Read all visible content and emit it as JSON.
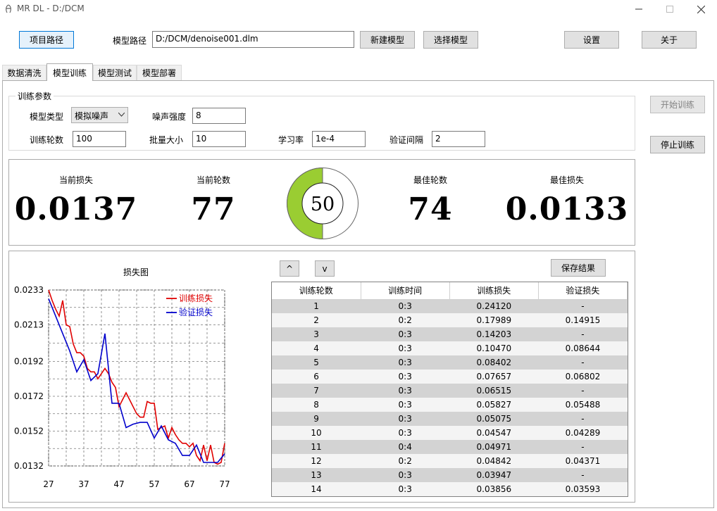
{
  "window": {
    "title": "MR DL - D:/DCM"
  },
  "toolbar": {
    "project_path_label": "项目路径",
    "model_path_label": "模型路径",
    "model_path_value": "D:/DCM/denoise001.dlm",
    "new_model_label": "新建模型",
    "select_model_label": "选择模型",
    "settings_label": "设置",
    "about_label": "关于"
  },
  "tabs": [
    {
      "label": "数据清洗"
    },
    {
      "label": "模型训练"
    },
    {
      "label": "模型测试"
    },
    {
      "label": "模型部署"
    }
  ],
  "params": {
    "group_title": "训练参数",
    "model_type_label": "模型类型",
    "model_type_value": "模拟噪声",
    "noise_label": "噪声强度",
    "noise_value": "8",
    "epochs_label": "训练轮数",
    "epochs_value": "100",
    "batch_label": "批量大小",
    "batch_value": "10",
    "lr_label": "学习率",
    "lr_value": "1e-4",
    "val_interval_label": "验证间隔",
    "val_interval_value": "2"
  },
  "actions": {
    "start_label": "开始训练",
    "stop_label": "停止训练"
  },
  "metrics": {
    "current_loss_label": "当前损失",
    "current_loss_value": "0.0137",
    "current_epoch_label": "当前轮数",
    "current_epoch_value": "77",
    "progress_value": "50",
    "progress_fraction": 0.5,
    "best_epoch_label": "最佳轮数",
    "best_epoch_value": "74",
    "best_loss_label": "最佳损失",
    "best_loss_value": "0.0133"
  },
  "colors": {
    "progress_fill": "#9acd32",
    "train_line": "#e00000",
    "val_line": "#0000cc"
  },
  "table": {
    "up_label": "^",
    "down_label": "v",
    "save_label": "保存结果",
    "columns": [
      "训练轮数",
      "训练时间",
      "训练损失",
      "验证损失"
    ],
    "rows": [
      [
        "1",
        "0:3",
        "0.24120",
        "-"
      ],
      [
        "2",
        "0:2",
        "0.17989",
        "0.14915"
      ],
      [
        "3",
        "0:3",
        "0.14203",
        "-"
      ],
      [
        "4",
        "0:3",
        "0.10470",
        "0.08644"
      ],
      [
        "5",
        "0:3",
        "0.08402",
        "-"
      ],
      [
        "6",
        "0:3",
        "0.07657",
        "0.06802"
      ],
      [
        "7",
        "0:3",
        "0.06515",
        "-"
      ],
      [
        "8",
        "0:3",
        "0.05827",
        "0.05488"
      ],
      [
        "9",
        "0:3",
        "0.05075",
        "-"
      ],
      [
        "10",
        "0:3",
        "0.04547",
        "0.04289"
      ],
      [
        "11",
        "0:4",
        "0.04971",
        "-"
      ],
      [
        "12",
        "0:2",
        "0.04842",
        "0.04371"
      ],
      [
        "13",
        "0:3",
        "0.03947",
        "-"
      ],
      [
        "14",
        "0:3",
        "0.03856",
        "0.03593"
      ]
    ]
  },
  "chart_data": {
    "type": "line",
    "title": "损失图",
    "xlim": [
      27,
      77
    ],
    "ylim": [
      0.0132,
      0.0233
    ],
    "x_ticks": [
      "27",
      "37",
      "47",
      "57",
      "67",
      "77"
    ],
    "y_ticks": [
      "0.0233",
      "0.0213",
      "0.0192",
      "0.0172",
      "0.0152",
      "0.0132"
    ],
    "grid": true,
    "legend": "top-right",
    "series": [
      {
        "name": "训练损失",
        "color": "#e00000",
        "x": [
          27,
          28,
          29,
          30,
          31,
          32,
          33,
          34,
          35,
          36,
          37,
          38,
          39,
          40,
          41,
          42,
          43,
          44,
          45,
          46,
          47,
          48,
          49,
          50,
          51,
          52,
          53,
          54,
          55,
          56,
          57,
          58,
          59,
          60,
          61,
          62,
          63,
          64,
          65,
          66,
          67,
          68,
          69,
          70,
          71,
          72,
          73,
          74,
          75,
          76,
          77
        ],
        "y": [
          0.0233,
          0.0227,
          0.0222,
          0.0218,
          0.0227,
          0.0213,
          0.0212,
          0.0202,
          0.0197,
          0.0197,
          0.0195,
          0.0188,
          0.0186,
          0.0186,
          0.0182,
          0.0185,
          0.0188,
          0.0185,
          0.018,
          0.0177,
          0.0166,
          0.017,
          0.0174,
          0.017,
          0.0166,
          0.0162,
          0.016,
          0.016,
          0.0169,
          0.0168,
          0.0168,
          0.0153,
          0.0154,
          0.0155,
          0.0148,
          0.0154,
          0.015,
          0.0147,
          0.0145,
          0.0145,
          0.0143,
          0.0145,
          0.0138,
          0.0135,
          0.0144,
          0.0135,
          0.0144,
          0.0134,
          0.0133,
          0.0134,
          0.0145
        ]
      },
      {
        "name": "验证损失",
        "color": "#0000cc",
        "x": [
          27,
          29,
          31,
          33,
          35,
          37,
          39,
          41,
          43,
          45,
          47,
          49,
          51,
          53,
          55,
          57,
          59,
          61,
          63,
          65,
          67,
          69,
          71,
          73,
          75,
          77
        ],
        "y": [
          0.0228,
          0.0218,
          0.0208,
          0.0198,
          0.0186,
          0.0193,
          0.0181,
          0.0185,
          0.0208,
          0.0168,
          0.0168,
          0.0154,
          0.0156,
          0.0157,
          0.0157,
          0.0148,
          0.0155,
          0.0147,
          0.0145,
          0.0138,
          0.0138,
          0.0144,
          0.0134,
          0.0134,
          0.0134,
          0.0139
        ]
      }
    ]
  }
}
